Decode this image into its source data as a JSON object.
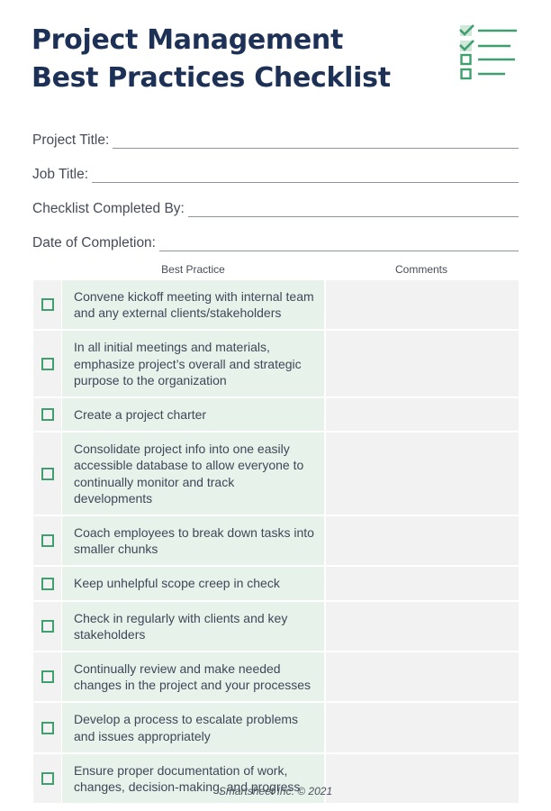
{
  "header": {
    "title_line1": "Project Management",
    "title_line2": "Best Practices Checklist",
    "logo_icon": "checklist-icon",
    "colors": {
      "title": "#1d3157",
      "accent": "#3f9f6f",
      "accent_light": "#cfe8d9"
    }
  },
  "fields": [
    {
      "label": "Project Title:",
      "value": ""
    },
    {
      "label": "Job Title:",
      "value": ""
    },
    {
      "label": "Checklist Completed By:",
      "value": ""
    },
    {
      "label": "Date of Completion:",
      "value": ""
    }
  ],
  "table": {
    "headers": {
      "practice": "Best Practice",
      "comments": "Comments"
    },
    "rows": [
      {
        "checked": false,
        "practice": "Convene kickoff meeting with internal team and any external clients/stakeholders",
        "comments": ""
      },
      {
        "checked": false,
        "practice": "In all initial meetings and materials, emphasize project’s overall and strategic purpose to the organization",
        "comments": ""
      },
      {
        "checked": false,
        "practice": "Create a project charter",
        "comments": ""
      },
      {
        "checked": false,
        "practice": "Consolidate project info into one easily accessible database to allow everyone to continually monitor and track developments",
        "comments": ""
      },
      {
        "checked": false,
        "practice": "Coach employees to break down tasks into smaller chunks",
        "comments": ""
      },
      {
        "checked": false,
        "practice": "Keep unhelpful scope creep in check",
        "comments": ""
      },
      {
        "checked": false,
        "practice": "Check in regularly with clients and key stakeholders",
        "comments": ""
      },
      {
        "checked": false,
        "practice": "Continually review and make needed changes in the project and your processes",
        "comments": ""
      },
      {
        "checked": false,
        "practice": "Develop a process to escalate problems and issues appropriately",
        "comments": ""
      },
      {
        "checked": false,
        "practice": "Ensure proper documentation of work, changes, decision-making, and progress",
        "comments": ""
      }
    ],
    "colors": {
      "practice_bg": "#e6f2ea",
      "neutral_bg": "#f2f2f2",
      "checkbox": "#3f9f6f"
    }
  },
  "footer": {
    "text": "Smartsheet Inc. © 2021"
  }
}
